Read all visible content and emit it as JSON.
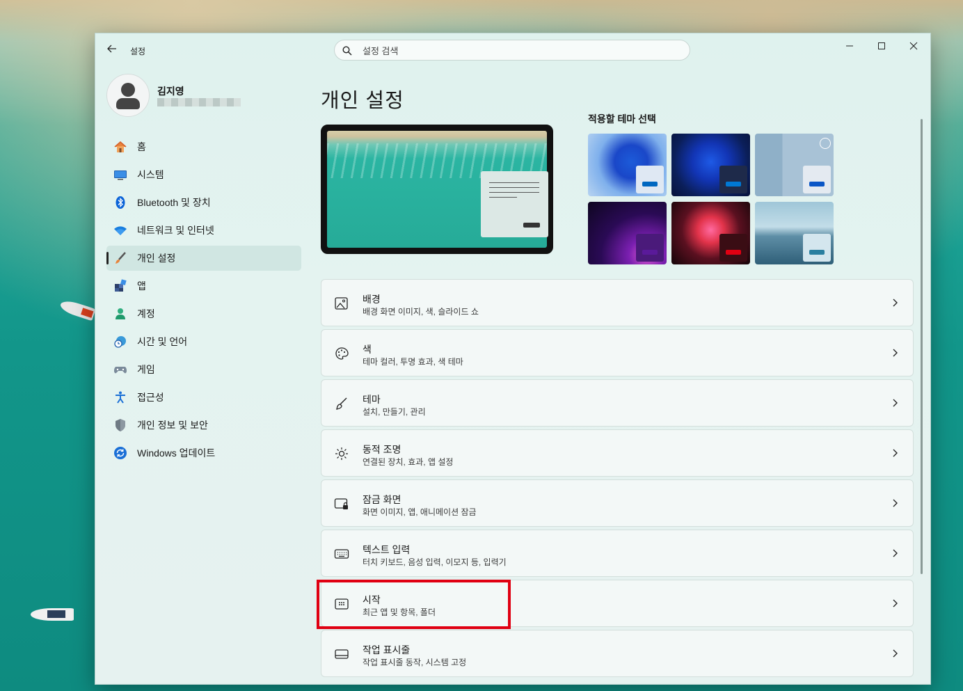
{
  "window": {
    "app_title": "설정",
    "search_placeholder": "설정 검색",
    "controls": {
      "minimize": "–",
      "maximize": "☐",
      "close": "✕"
    }
  },
  "profile": {
    "name": "김지영"
  },
  "nav": {
    "items": [
      {
        "label": "홈",
        "icon": "home-icon"
      },
      {
        "label": "시스템",
        "icon": "system-icon"
      },
      {
        "label": "Bluetooth 및 장치",
        "icon": "bluetooth-icon"
      },
      {
        "label": "네트워크 및 인터넷",
        "icon": "wifi-icon"
      },
      {
        "label": "개인 설정",
        "icon": "brush-icon",
        "active": true
      },
      {
        "label": "앱",
        "icon": "apps-icon"
      },
      {
        "label": "계정",
        "icon": "account-icon"
      },
      {
        "label": "시간 및 언어",
        "icon": "globe-clock-icon"
      },
      {
        "label": "게임",
        "icon": "gamepad-icon"
      },
      {
        "label": "접근성",
        "icon": "accessibility-icon"
      },
      {
        "label": "개인 정보 및 보안",
        "icon": "shield-icon"
      },
      {
        "label": "Windows 업데이트",
        "icon": "update-icon"
      }
    ]
  },
  "main": {
    "title": "개인 설정",
    "themes_title": "적용할 테마 선택",
    "themes": [
      {
        "name": "windows-light",
        "accent": "#0067c0"
      },
      {
        "name": "windows-dark",
        "accent": "#0078d4"
      },
      {
        "name": "flowers",
        "accent": "#0a56c6"
      },
      {
        "name": "glow",
        "accent": "#5a1a9a"
      },
      {
        "name": "captured-motion",
        "accent": "#e00012"
      },
      {
        "name": "sunrise",
        "accent": "#2a7fa0"
      }
    ],
    "settings": [
      {
        "title": "배경",
        "subtitle": "배경 화면 이미지, 색, 슬라이드 쇼",
        "icon": "image-icon"
      },
      {
        "title": "색",
        "subtitle": "테마 컬러, 투명 효과, 색 테마",
        "icon": "palette-icon"
      },
      {
        "title": "테마",
        "subtitle": "설치, 만들기, 관리",
        "icon": "brush-icon"
      },
      {
        "title": "동적 조명",
        "subtitle": "연결된 장치, 효과, 앱 설정",
        "icon": "dynamic-lighting-icon"
      },
      {
        "title": "잠금 화면",
        "subtitle": "화면 이미지, 앱, 애니메이션 잠금",
        "icon": "lock-screen-icon"
      },
      {
        "title": "텍스트 입력",
        "subtitle": "터치 키보드, 음성 입력, 이모지 등, 입력기",
        "icon": "keyboard-icon"
      },
      {
        "title": "시작",
        "subtitle": "최근 앱 및 항목, 폴더",
        "icon": "start-icon"
      },
      {
        "title": "작업 표시줄",
        "subtitle": "작업 표시줄 동작, 시스템 고정",
        "icon": "taskbar-icon"
      }
    ]
  },
  "colors": {
    "highlight": "#e00012",
    "accent": "#0067c0"
  }
}
